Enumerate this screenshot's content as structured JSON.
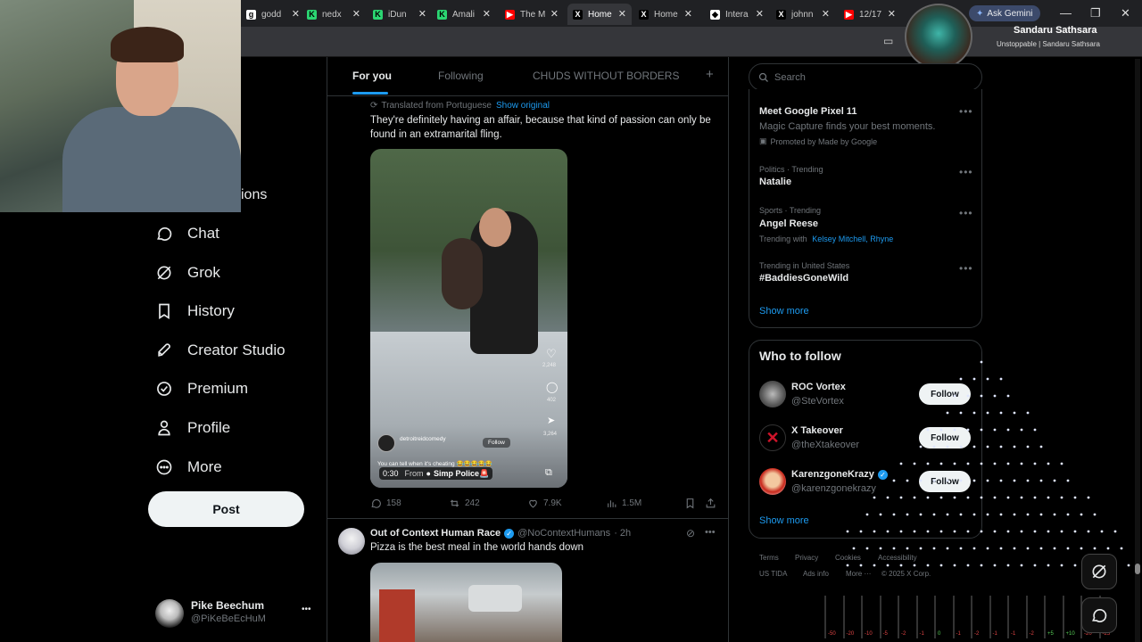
{
  "browser": {
    "tabs": [
      {
        "title": "godd",
        "fav": "g",
        "color": "#ffffff"
      },
      {
        "title": "nedx",
        "fav": "K",
        "color": "#2bd672"
      },
      {
        "title": "iDun",
        "fav": "K",
        "color": "#2bd672"
      },
      {
        "title": "Amali",
        "fav": "K",
        "color": "#2bd672"
      },
      {
        "title": "The M",
        "fav": "▶",
        "color": "#ff0000"
      },
      {
        "title": "Home",
        "fav": "X",
        "color": "#000000"
      },
      {
        "title": "Home",
        "fav": "X",
        "color": "#000000"
      },
      {
        "title": "Intera",
        "fav": "◆",
        "color": "#ffffff"
      },
      {
        "title": "johnn",
        "fav": "X",
        "color": "#000000"
      },
      {
        "title": "12/17",
        "fav": "▶",
        "color": "#ff0000"
      }
    ],
    "gemini_label": "Ask Gemini"
  },
  "overlay": {
    "streamer_name": "Sandaru Sathsara",
    "streamer_tagline": "Unstoppable | Sandaru Sathsara"
  },
  "nav": {
    "partial_label": "ions",
    "items": [
      {
        "label": "Chat",
        "icon": "chat-icon"
      },
      {
        "label": "Grok",
        "icon": "grok-icon"
      },
      {
        "label": "History",
        "icon": "bookmark-icon"
      },
      {
        "label": "Creator Studio",
        "icon": "rocket-icon"
      },
      {
        "label": "Premium",
        "icon": "verified-icon"
      },
      {
        "label": "Profile",
        "icon": "person-icon"
      },
      {
        "label": "More",
        "icon": "more-circle-icon"
      }
    ],
    "post_label": "Post",
    "account": {
      "name": "Pike Beechum",
      "handle": "@PiKeBeEcHuM",
      "menu": "•••"
    }
  },
  "feed": {
    "tabs": [
      "For you",
      "Following",
      "CHUDS WITHOUT BORDERS"
    ],
    "add_tab": "+",
    "post1": {
      "translated": "Translated from Portuguese",
      "show_original": "Show original",
      "text": "They're definitely having an affair, because that kind of passion can only be found in an extramarital fling.",
      "video": {
        "likes": "2,248",
        "comments": "402",
        "shares": "3,264",
        "creator": "detroitreidcomedy",
        "follow": "Follow",
        "caption": "You can tell when it's cheating 😂😂😂😂😂",
        "time": "0:30",
        "from": "From",
        "source": "Simp Police🚨"
      },
      "stats": {
        "replies": "158",
        "reposts": "242",
        "likes": "7.9K",
        "views": "1.5M"
      }
    },
    "post2": {
      "name": "Out of Context Human Race",
      "handle": "@NoContextHumans",
      "time": "· 2h",
      "text": "Pizza is the best meal in the world hands down"
    }
  },
  "sidebar": {
    "search_placeholder": "Search",
    "ad": {
      "title": "Meet Google Pixel 11",
      "body": "Magic Capture finds your best moments.",
      "promoted": "Promoted by Made by Google"
    },
    "trends": [
      {
        "meta": "Politics · Trending",
        "name": "Natalie"
      },
      {
        "meta": "Sports · Trending",
        "name": "Angel Reese",
        "extra_prefix": "Trending with",
        "extra_links": "Kelsey Mitchell, Rhyne"
      },
      {
        "meta": "Trending in United States",
        "name": "#BaddiesGoneWild"
      }
    ],
    "show_more": "Show more",
    "who_to_follow": {
      "title": "Who to follow",
      "accounts": [
        {
          "name": "ROC Vortex",
          "handle": "@SteVortex",
          "follow": "Follow",
          "color": "#8a8a8a"
        },
        {
          "name": "X Takeover",
          "handle": "@theXtakeover",
          "follow": "Follow",
          "color": "#c0141c"
        },
        {
          "name": "KarenzgoneKrazy",
          "handle": "@karenzgonekrazy",
          "follow": "Follow",
          "color": "#d8402a"
        }
      ],
      "show_more": "Show more"
    },
    "footer": {
      "row1": [
        "Terms",
        "Privacy",
        "Cookies",
        "Accessibility"
      ],
      "row2": [
        "US TIDA",
        "Ads info",
        "More ···",
        "© 2025 X Corp."
      ]
    }
  },
  "mixer": {
    "labels": [
      "-50",
      "-20",
      "-10",
      "-5",
      "-2",
      "-1",
      "0",
      "-1",
      "-2",
      "-1",
      "-1",
      "-2",
      "+5",
      "+10",
      "-20",
      "-25"
    ]
  }
}
